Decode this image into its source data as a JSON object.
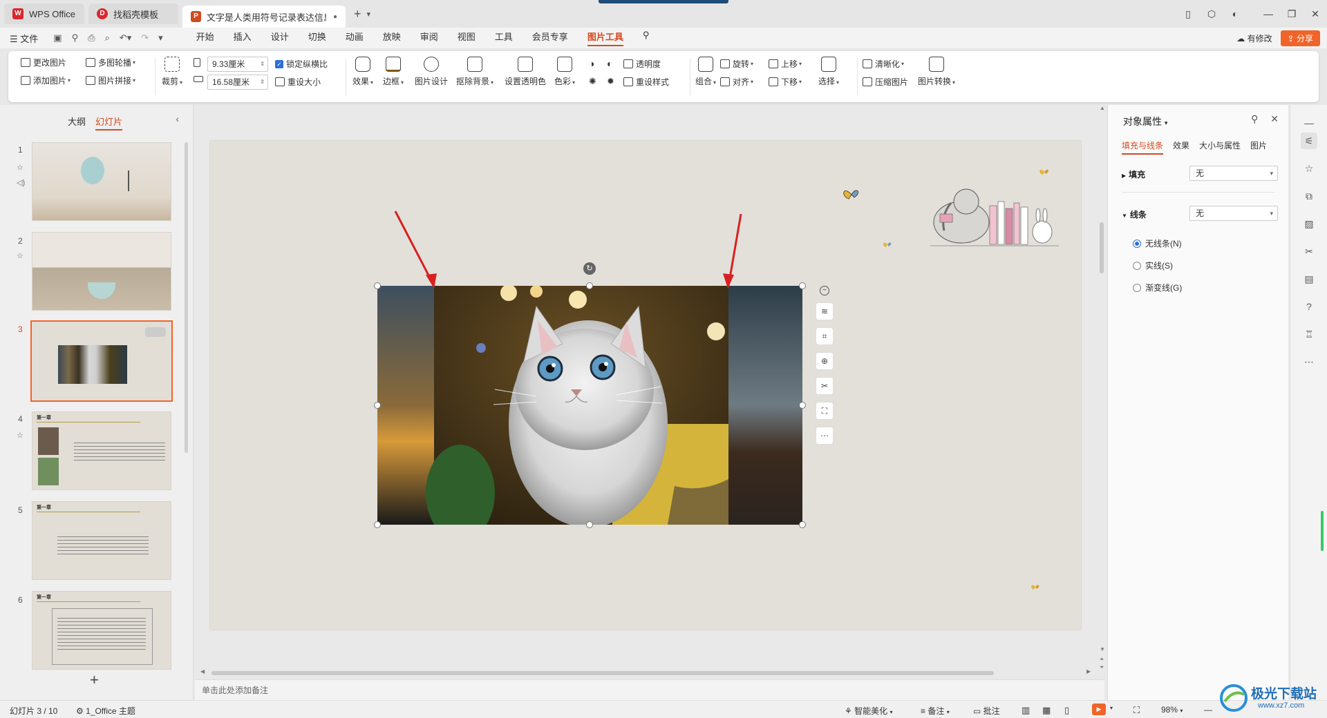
{
  "tabs": [
    {
      "label": "WPS Office",
      "logo": "W",
      "color": "#d9272e"
    },
    {
      "label": "找稻壳模板",
      "logo": "D",
      "color": "#d9272e"
    },
    {
      "label": "文字是人类用符号记录表达信息以",
      "logo": "P",
      "color": "#d24a1f"
    }
  ],
  "menu": {
    "file": "☰ 文件",
    "items": [
      "开始",
      "插入",
      "设计",
      "切换",
      "动画",
      "放映",
      "审阅",
      "视图",
      "工具",
      "会员专享",
      "图片工具"
    ],
    "active": "图片工具",
    "changed": "有修改",
    "share": "分享"
  },
  "ribbon": {
    "change_picture": "更改图片",
    "add_picture": "添加图片",
    "multi_carousel": "多图轮播",
    "picture_collage": "图片拼接",
    "crop": "裁剪",
    "width": "9.33厘米",
    "height": "16.58厘米",
    "lock_ratio": "锁定纵横比",
    "reset_size": "重设大小",
    "effects": "效果",
    "border": "边框",
    "picture_design": "图片设计",
    "remove_bg": "抠除背景",
    "set_transparent": "设置透明色",
    "color": "色彩",
    "transparency": "透明度",
    "reset_style": "重设样式",
    "group": "组合",
    "rotate": "旋转",
    "align": "对齐",
    "bring_forward": "上移",
    "send_backward": "下移",
    "select": "选择",
    "sharpen": "清晰化",
    "compress": "压缩图片",
    "convert": "图片转换"
  },
  "left_panel": {
    "tab_outline": "大纲",
    "tab_slides": "幻灯片",
    "slides": [
      {
        "num": "1"
      },
      {
        "num": "2"
      },
      {
        "num": "3"
      },
      {
        "num": "4"
      },
      {
        "num": "5"
      },
      {
        "num": "6"
      }
    ],
    "thumb_heading": "第一章"
  },
  "notes_placeholder": "单击此处添加备注",
  "right_panel": {
    "title": "对象属性",
    "tabs": [
      "填充与线条",
      "效果",
      "大小与属性",
      "图片"
    ],
    "fill_label": "填充",
    "fill_value": "无",
    "line_label": "线条",
    "line_value": "无",
    "options": [
      "无线条(N)",
      "实线(S)",
      "渐变线(G)"
    ]
  },
  "status": {
    "slide_info": "幻灯片 3 / 10",
    "theme": "1_Office 主题",
    "beautify": "智能美化",
    "notes": "备注",
    "comments": "批注",
    "zoom": "98%"
  },
  "watermark": {
    "text": "极光下载站",
    "url": "www.xz7.com"
  },
  "colors": {
    "accent": "#d24a1f",
    "share": "#f0642a",
    "arrow": "#d82020",
    "select_blue": "#2b6fd6"
  }
}
